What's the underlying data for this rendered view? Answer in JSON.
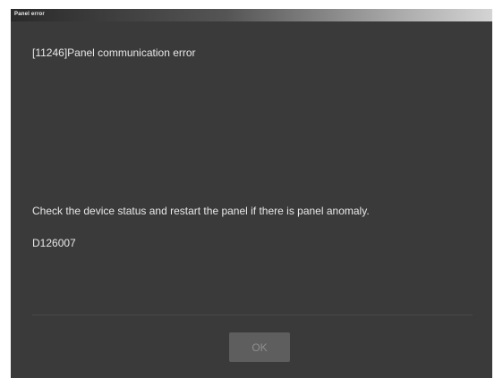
{
  "window": {
    "title": "Panel error"
  },
  "error": {
    "code_line": "[11246]Panel communication error",
    "message": "Check the device status and restart the panel if there is panel anomaly.",
    "detail_code": "D126007"
  },
  "actions": {
    "ok_label": "OK"
  },
  "colors": {
    "dialog_bg": "#3a3a3a",
    "text": "#e8e8e8",
    "button_bg": "#5e5e5e",
    "button_text": "#8e8e8e"
  }
}
